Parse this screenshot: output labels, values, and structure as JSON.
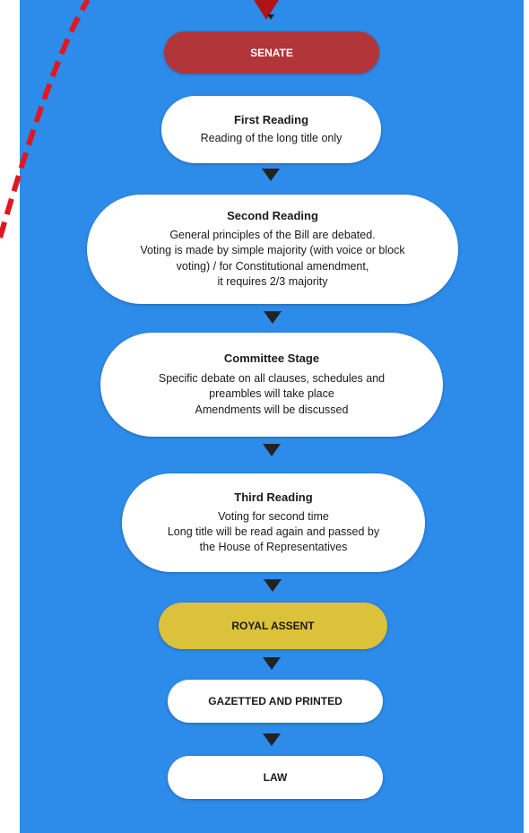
{
  "stages": {
    "senate": {
      "title": "SENATE"
    },
    "first_reading": {
      "title": "First Reading",
      "desc": "Reading of the long title only"
    },
    "second_reading": {
      "title": "Second Reading",
      "desc": "General principles of the Bill are debated.\nVoting is made by simple majority (with voice or block\nvoting) / for Constitutional amendment,\nit requires 2/3 majority"
    },
    "committee_stage": {
      "title": "Committee Stage",
      "desc": "Specific debate on all clauses, schedules and\npreambles will take place\nAmendments will be discussed"
    },
    "third_reading": {
      "title": "Third Reading",
      "desc": "Voting for second time\nLong title will be read again and passed by\nthe House of Representatives"
    },
    "royal_assent": {
      "title": "ROYAL ASSENT"
    },
    "gazetted": {
      "title": "GAZETTED AND PRINTED"
    },
    "law": {
      "title": "LAW"
    }
  },
  "colors": {
    "background": "#2d8bea",
    "senate": "#b2353a",
    "royal_assent": "#dcc13b",
    "node": "#ffffff",
    "arrow": "#222222",
    "dashed_connector": "#e0181f"
  }
}
